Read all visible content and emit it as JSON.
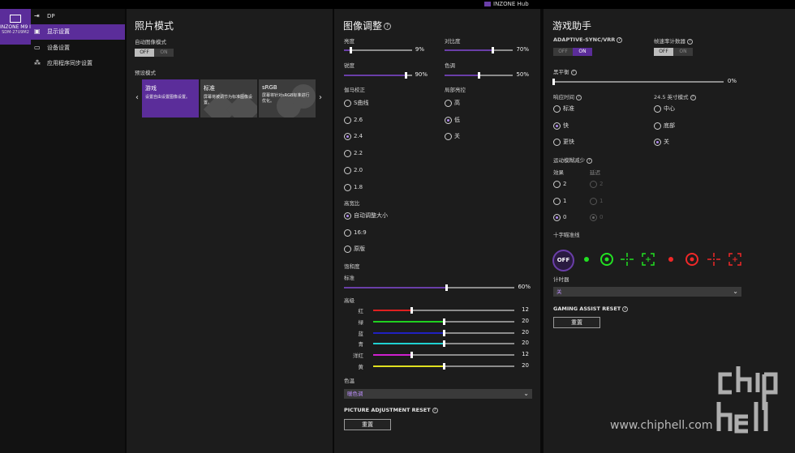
{
  "app_title": "INZONE Hub",
  "device": {
    "name": "INZONE M9 II",
    "model": "SDM-27U9M2"
  },
  "nav": [
    {
      "label": "DP",
      "icon": "input-icon"
    },
    {
      "label": "显示设置",
      "icon": "display-icon",
      "active": true
    },
    {
      "label": "设备设置",
      "icon": "monitor-icon"
    },
    {
      "label": "应用程序同步设置",
      "icon": "grid-icon"
    }
  ],
  "photo": {
    "title": "照片模式",
    "auto_label": "自动图像模式",
    "auto_toggle": {
      "off": "OFF",
      "on": "ON",
      "value": "OFF"
    },
    "preset_label": "预设模式",
    "presets": [
      {
        "title": "游戏",
        "desc": "设置自由设置图像设置。",
        "selected": true
      },
      {
        "title": "标准",
        "desc": "屏幕将被调节为标准图像设置。"
      },
      {
        "title": "sRGB",
        "desc": "屏幕将针对sRGB标准进行优化。"
      }
    ]
  },
  "image": {
    "title": "图像调整",
    "brightness": {
      "label": "亮度",
      "value": "9%",
      "pct": 9
    },
    "contrast": {
      "label": "对比度",
      "value": "70%",
      "pct": 70
    },
    "sharpness": {
      "label": "锐度",
      "value": "90%",
      "pct": 90
    },
    "hue": {
      "label": "色调",
      "value": "50%",
      "pct": 50
    },
    "gamma": {
      "label": "伽马校正",
      "options": [
        "S曲线",
        "2.6",
        "2.4",
        "2.2",
        "2.0",
        "1.8"
      ],
      "selected": "2.4"
    },
    "local_dimming": {
      "label": "局部亮控",
      "options": [
        "高",
        "低",
        "关"
      ],
      "selected": "低"
    },
    "aspect": {
      "label": "高宽比",
      "options": [
        "自动调整大小",
        "16:9",
        "原版"
      ],
      "selected": "自动调整大小"
    },
    "saturation": {
      "label": "饱和度",
      "sub": "标准",
      "value": "60%",
      "pct": 60
    },
    "advanced": {
      "label": "高级",
      "colors": [
        {
          "label": "红",
          "value": "12",
          "pct": 27,
          "color": "#e02020"
        },
        {
          "label": "绿",
          "value": "20",
          "pct": 50,
          "color": "#20d020"
        },
        {
          "label": "蓝",
          "value": "20",
          "pct": 50,
          "color": "#2020c0"
        },
        {
          "label": "青",
          "value": "20",
          "pct": 50,
          "color": "#20d0d0"
        },
        {
          "label": "洋红",
          "value": "12",
          "pct": 27,
          "color": "#d020d0"
        },
        {
          "label": "黄",
          "value": "20",
          "pct": 50,
          "color": "#e0e020"
        }
      ]
    },
    "color_temp": {
      "label": "色温",
      "value": "暖色调"
    },
    "reset": {
      "label": "PICTURE ADJUSTMENT RESET",
      "button": "重置"
    }
  },
  "game": {
    "title": "游戏助手",
    "vrr": {
      "label": "ADAPTIVE-SYNC/VRR",
      "off": "OFF",
      "on": "ON",
      "value": "ON"
    },
    "fps_counter": {
      "label": "帧速率计数器",
      "off": "OFF",
      "on": "ON",
      "value": "OFF"
    },
    "black_eq": {
      "label": "黑平衡",
      "value": "0%",
      "pct": 0
    },
    "response": {
      "label": "响应时间",
      "options": [
        "标准",
        "快",
        "更快"
      ],
      "selected": "快"
    },
    "mode245": {
      "label": "24.5 英寸模式",
      "options": [
        "中心",
        "底部",
        "关"
      ],
      "selected": "关"
    },
    "motion_blur": {
      "label": "运动模糊减少",
      "effect_label": "效果",
      "delay_label": "延迟",
      "effect": [
        "2",
        "1",
        "0"
      ],
      "delay": [
        "2",
        "1",
        "0"
      ],
      "selected": "0"
    },
    "crosshair": {
      "label": "十字瞄准线",
      "off": "OFF"
    },
    "timer": {
      "label": "计时器",
      "value": "关"
    },
    "reset": {
      "label": "GAMING ASSIST RESET",
      "button": "重置"
    }
  },
  "watermark": "www.chiphell.com"
}
